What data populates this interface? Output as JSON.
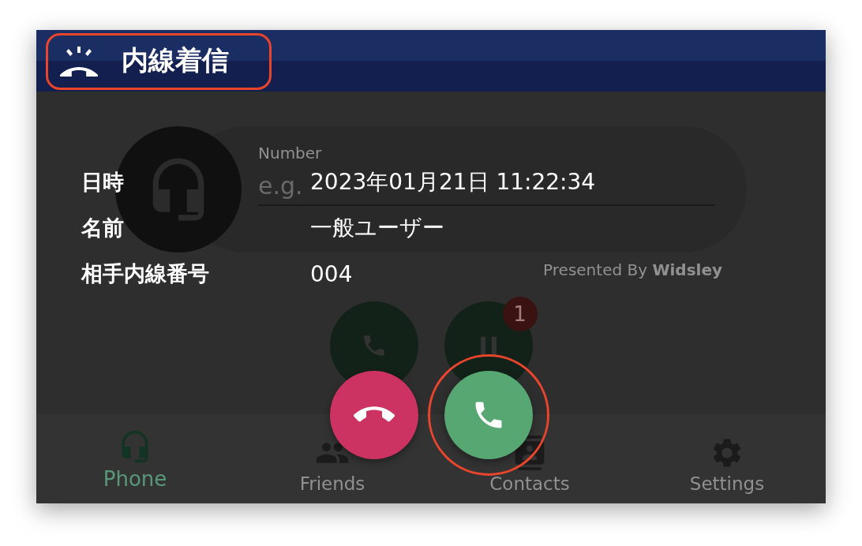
{
  "header": {
    "title": "内線着信"
  },
  "dialer": {
    "number_label": "Number",
    "placeholder": "e.g.",
    "credit": "Presented By **Widsley**"
  },
  "call_buttons": [
    {
      "kind": "call"
    },
    {
      "kind": "hold",
      "badge": "1"
    }
  ],
  "nav": [
    {
      "kind": "phone",
      "label": "Phone",
      "selected": true
    },
    {
      "kind": "friends",
      "label": "Friends",
      "selected": false
    },
    {
      "kind": "contacts",
      "label": "Contacts",
      "selected": false
    },
    {
      "kind": "settings",
      "label": "Settings",
      "selected": false
    }
  ],
  "incoming_call": {
    "rows": [
      {
        "label": "日時",
        "value": "2023年01月21日 11:22:34"
      },
      {
        "label": "名前",
        "value": "一般ユーザー"
      },
      {
        "label": "相手内線番号",
        "value": "004"
      }
    ],
    "actions": [
      {
        "kind": "decline"
      },
      {
        "kind": "accept"
      }
    ]
  }
}
